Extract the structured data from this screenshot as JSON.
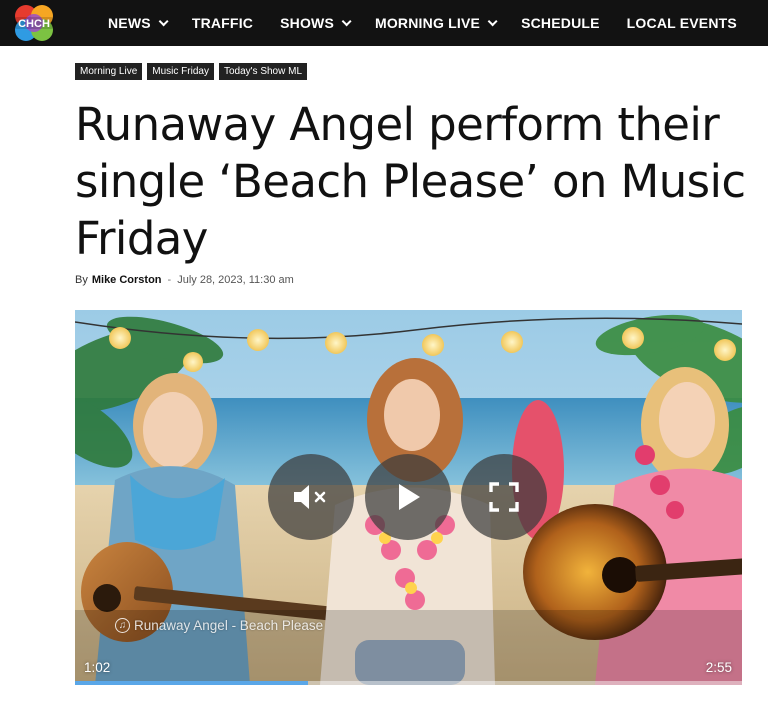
{
  "site": {
    "logo_text": "CHCH"
  },
  "nav": {
    "items": [
      {
        "label": "NEWS",
        "dropdown": true
      },
      {
        "label": "TRAFFIC",
        "dropdown": false
      },
      {
        "label": "SHOWS",
        "dropdown": true
      },
      {
        "label": "MORNING LIVE",
        "dropdown": true
      },
      {
        "label": "SCHEDULE",
        "dropdown": false
      },
      {
        "label": "LOCAL EVENTS",
        "dropdown": false
      }
    ]
  },
  "tags": [
    "Morning Live",
    "Music Friday",
    "Today's Show ML"
  ],
  "article": {
    "title": "Runaway Angel perform their single ‘Beach Please’ on Music Friday",
    "by": "By",
    "author": "Mike Corston",
    "separator": "-",
    "date": "July 28, 2023, 11:30 am"
  },
  "video": {
    "track_label": "Runaway Angel - Beach Please",
    "elapsed": "1:02",
    "duration": "2:55",
    "progress": 0.35,
    "controls": [
      "mute-icon",
      "play-icon",
      "fullscreen-icon"
    ]
  },
  "colors": {
    "nav_bg": "#121212",
    "tag_bg": "#222222",
    "progress_fill": "#5aa7e8"
  }
}
